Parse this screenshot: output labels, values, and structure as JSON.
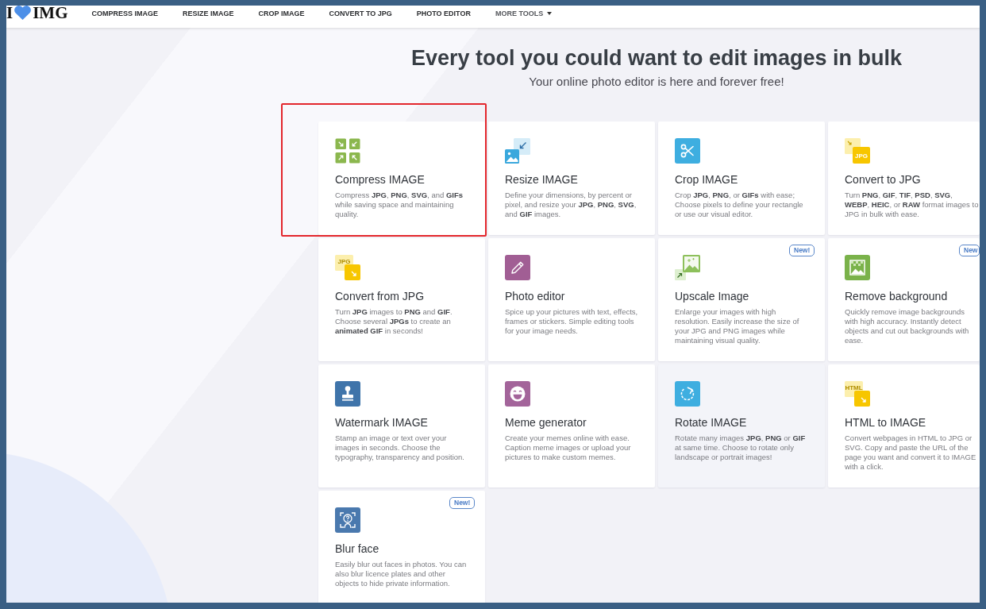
{
  "logo": {
    "left": "I",
    "right": "IMG"
  },
  "nav": [
    {
      "label": "COMPRESS IMAGE",
      "kind": "link"
    },
    {
      "label": "RESIZE IMAGE",
      "kind": "link"
    },
    {
      "label": "CROP IMAGE",
      "kind": "link"
    },
    {
      "label": "CONVERT TO JPG",
      "kind": "link"
    },
    {
      "label": "PHOTO EDITOR",
      "kind": "link"
    },
    {
      "label": "MORE TOOLS",
      "kind": "dropdown"
    }
  ],
  "hero": {
    "title": "Every tool you could want to edit images in bulk",
    "subtitle": "Your online photo editor is here and forever free!"
  },
  "cards": [
    {
      "kind": "compress",
      "title": "Compress IMAGE",
      "description": "Compress **JPG**, **PNG**, **SVG**, and **GIFs** while saving space and maintaining quality.",
      "highlighted": true,
      "hovered": false
    },
    {
      "kind": "resize",
      "title": "Resize IMAGE",
      "description": "Define your dimensions, by percent or pixel, and resize your **JPG**, **PNG**, **SVG**, and **GIF** images.",
      "highlighted": false,
      "hovered": false
    },
    {
      "kind": "crop",
      "title": "Crop IMAGE",
      "description": "Crop **JPG**, **PNG**, or **GIFs** with ease; Choose pixels to define your rectangle or use our visual editor.",
      "highlighted": false,
      "hovered": false
    },
    {
      "kind": "tojpg",
      "icon_text": "JPG",
      "title": "Convert to JPG",
      "description": "Turn **PNG**, **GIF**, **TIF**, **PSD**, **SVG**, **WEBP**, **HEIC**, or **RAW** format images to JPG in bulk with ease.",
      "highlighted": false,
      "hovered": false
    },
    {
      "kind": "fromjpg",
      "icon_text": "JPG",
      "title": "Convert from JPG",
      "description": "Turn **JPG** images to **PNG** and **GIF**. Choose several **JPGs** to create an **animated GIF** in seconds!",
      "highlighted": false,
      "hovered": false
    },
    {
      "kind": "editor",
      "title": "Photo editor",
      "description": "Spice up your pictures with text, effects, frames or stickers. Simple editing tools for your image needs.",
      "highlighted": false,
      "hovered": false
    },
    {
      "kind": "upscale",
      "title": "Upscale Image",
      "badge": "New!",
      "description": "Enlarge your images with high resolution. Easily increase the size of your JPG and PNG images while maintaining visual quality.",
      "highlighted": false,
      "hovered": false
    },
    {
      "kind": "removebg",
      "title": "Remove background",
      "badge": "New",
      "description": "Quickly remove image backgrounds with high accuracy. Instantly detect objects and cut out backgrounds with ease.",
      "highlighted": false,
      "hovered": false
    },
    {
      "kind": "watermark",
      "title": "Watermark IMAGE",
      "description": "Stamp an image or text over your images in seconds. Choose the typography, transparency and position.",
      "highlighted": false,
      "hovered": false
    },
    {
      "kind": "meme",
      "title": "Meme generator",
      "description": "Create your memes online with ease. Caption meme images or upload your pictures to make custom memes.",
      "highlighted": false,
      "hovered": false
    },
    {
      "kind": "rotate",
      "title": "Rotate IMAGE",
      "description": "Rotate many images **JPG**, **PNG** or **GIF** at same time. Choose to rotate only landscape or portrait images!",
      "highlighted": false,
      "hovered": true
    },
    {
      "kind": "htmltoimage",
      "icon_text": "HTML",
      "title": "HTML to IMAGE",
      "description": "Convert webpages in HTML to JPG or SVG. Copy and paste the URL of the page you want and convert it to IMAGE with a click.",
      "highlighted": false,
      "hovered": false
    },
    {
      "kind": "blurface",
      "title": "Blur face",
      "badge": "New!",
      "description": "Easily blur out faces in photos. You can also blur licence plates and other objects to hide private information.",
      "highlighted": false,
      "hovered": false
    }
  ]
}
